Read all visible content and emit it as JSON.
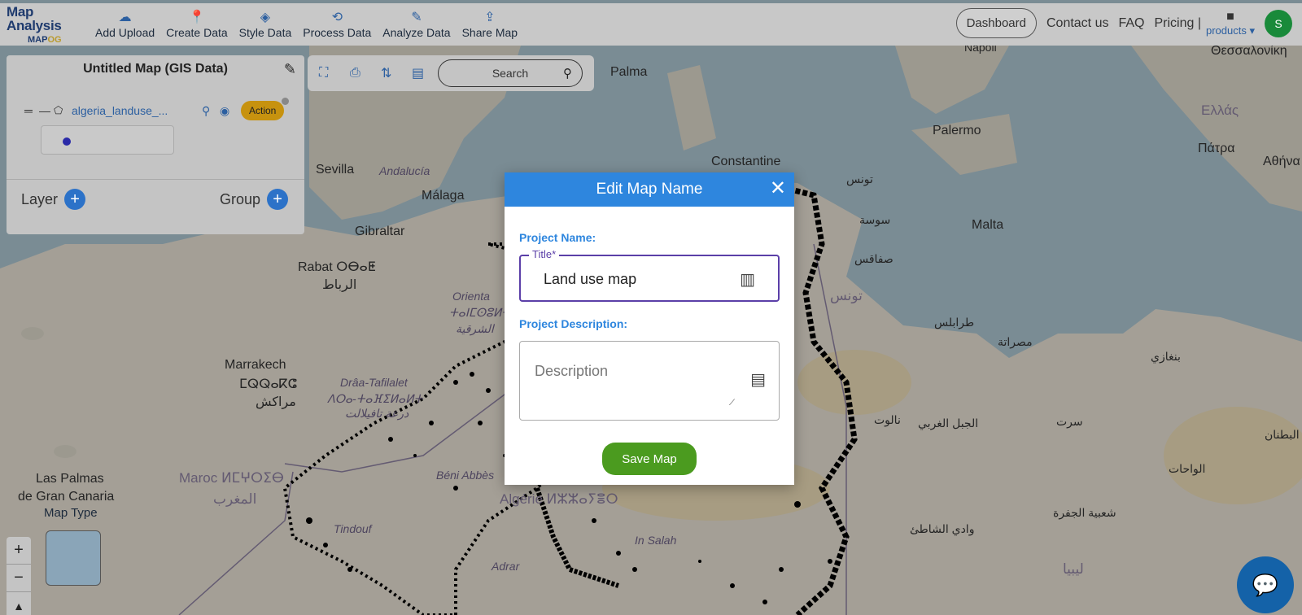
{
  "brand": {
    "title": "Map Analysis",
    "sub_left": "MAP",
    "sub_right": "OG"
  },
  "nav": [
    {
      "label": "Add Upload",
      "icon": "☁"
    },
    {
      "label": "Create Data",
      "icon": "📍"
    },
    {
      "label": "Style Data",
      "icon": "◈"
    },
    {
      "label": "Process Data",
      "icon": "⟲"
    },
    {
      "label": "Analyze Data",
      "icon": "✎"
    },
    {
      "label": "Share Map",
      "icon": "⇪"
    }
  ],
  "top_right": {
    "dashboard": "Dashboard",
    "contact": "Contact us",
    "faq": "FAQ",
    "pricing": "Pricing |",
    "products": "products ▾",
    "avatar": "S"
  },
  "layer_panel": {
    "map_title": "Untitled Map (GIS Data)",
    "layer_name": "algeria_landuse_...",
    "action_label": "Action",
    "layer_btn": "Layer",
    "group_btn": "Group"
  },
  "toolbar": {
    "search_label": "Search"
  },
  "map_type": {
    "label": "Map Type"
  },
  "map_labels": {
    "palma": "Palma",
    "palermo": "Palermo",
    "sevilla": "Sevilla",
    "andalucia": "Andalucía",
    "malaga": "Málaga",
    "constantine": "Constantine",
    "gibraltar": "Gibraltar",
    "rabat": "Rabat ⵔⴱⴰⵟ",
    "rabat_ar": "الرباط",
    "malta": "Malta",
    "oriental": "Orienta",
    "oriental2": "ⵜⴰⵏⵎⵙⵓⵍⵜ",
    "oriental_ar": "الشرقية",
    "marrakech": "Marrakech",
    "marrakech_tz": "ⵎⵕⵕⴰⴽⵛ",
    "marrakech_ar": "مراكش",
    "draa": "Drâa-Tafilalet",
    "draa_tz": "ⴷⵔⴰ-ⵜⴰⴼⵉⵍⴰⵍⵜ",
    "draa_ar": "درعة تافيلالت",
    "maroc": "Maroc ⵍⵎⵖⵔⵉⴱ",
    "maroc_ar": "المغرب",
    "las_palmas": "Las Palmas",
    "gran_canaria": "de Gran Canaria",
    "tindouf": "Tindouf",
    "beni_abbes": "Béni Abbès",
    "algerie": "Algérie ⵍⵣⵣⴰⵢⴻⵔ",
    "in_salah": "In Salah",
    "adrar": "Adrar",
    "ellas": "Ελλάς",
    "patra": "Πάτρα",
    "athina": "Αθήνα",
    "thessaloniki": "Θεσσαλονίκη",
    "tunis_ar": "تونس",
    "sousse_ar": "سوسة",
    "sfax_ar": "صفاقس",
    "tunisia_ar": "تونس",
    "tripoli_ar": "طرابلس",
    "misrata_ar": "مصراتة",
    "benghazi_ar": "بنغازي",
    "naloot_ar": "نالوت",
    "jabal_ar": "الجبل الغربي",
    "sirt_ar": "سرت",
    "waha_ar": "الواحات",
    "jufra_ar": "شعبية الجفرة",
    "shati_ar": "وادي الشاطئ",
    "libya_ar": "ليبيا",
    "butnan_ar": "البطنان",
    "napoli": "Napoli"
  },
  "modal": {
    "header": "Edit Map Name",
    "project_name_label": "Project Name:",
    "title_legend": "Title*",
    "title_value": "Land use map",
    "project_description_label": "Project Description:",
    "description_placeholder": "Description",
    "save_label": "Save Map"
  }
}
